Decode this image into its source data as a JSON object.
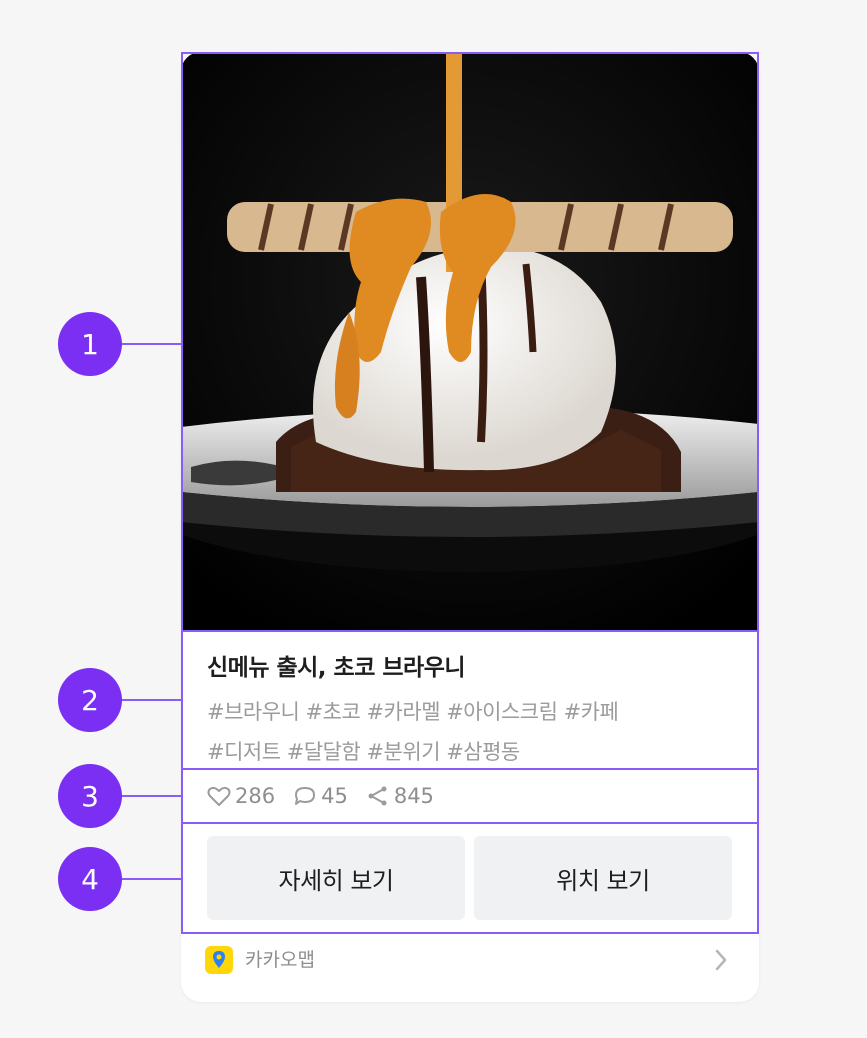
{
  "post": {
    "title": "신메뉴 출시, 초코 브라우니",
    "tags_line1": "#브라우니 #초코 #카라멜 #아이스크림 #카페",
    "tags_line2": "#디저트 #달달함 #분위기 #삼평동",
    "likes": "286",
    "comments": "45",
    "shares": "845",
    "photo_alt": "dessert-photo"
  },
  "actions": {
    "detail_label": "자세히 보기",
    "location_label": "위치 보기"
  },
  "footer": {
    "brand": "카카오맵",
    "brand_icon": "kakaomap-pin-icon",
    "chevron_icon": "chevron-right-icon"
  },
  "annotations": [
    "1",
    "2",
    "3",
    "4"
  ],
  "colors": {
    "accent": "#7b2ff2",
    "outline": "#8a5cf6",
    "button_bg": "#eff1f3",
    "brand_yellow": "#ffd60a",
    "muted_text": "#9b9b9b"
  }
}
